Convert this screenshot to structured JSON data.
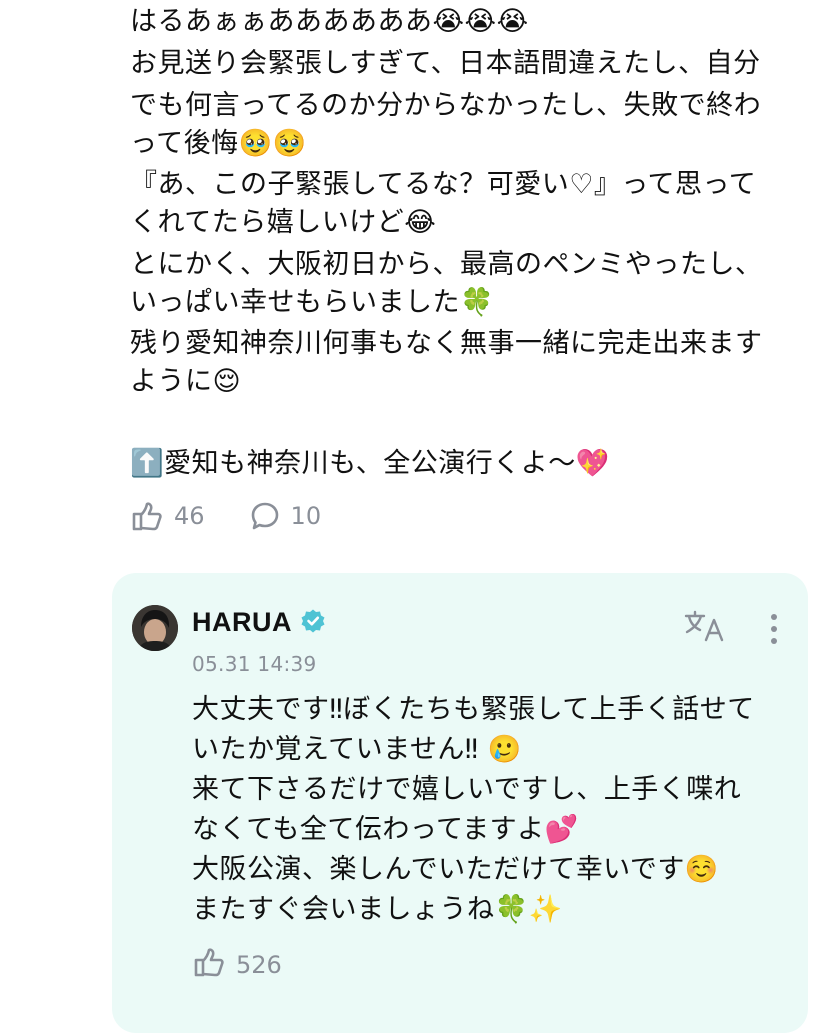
{
  "post": {
    "lines": [
      "はるあぁぁああああああ😭😭😭",
      "お見送り会緊張しすぎて、日本語間違えたし、自分",
      "でも何言ってるのか分からなかったし、失敗で終わ",
      "って後悔🥹🥹",
      "『あ、この子緊張してるな？可愛い♡』って思って",
      "くれてたら嬉しいけど😂",
      "とにかく、大阪初日から、最高のペンミやったし、",
      "いっぱい幸せもらいました🍀",
      "残り愛知神奈川何事もなく無事一緒に完走出来ます",
      "ように😌",
      "",
      "⬆️愛知も神奈川も、全公演行くよ〜💖"
    ],
    "like_count": "46",
    "comment_count": "10"
  },
  "reply": {
    "username": "HARUA",
    "timestamp": "05.31 14:39",
    "lines": [
      "大丈夫です‼︎ぼくたちも緊張して上手く話せて",
      "いたか覚えていません‼︎ 🥲",
      "来て下さるだけで嬉しいですし、上手く喋れ",
      "なくても全て伝わってますよ💕",
      "大阪公演、楽しんでいただけて幸いです☺️",
      "またすぐ会いましょうね🍀✨"
    ],
    "like_count": "526"
  },
  "colors": {
    "card_background": "#ebfaf7",
    "muted_text": "#8a8f98",
    "verified_badge": "#4fc3d4"
  },
  "icons": [
    "like-icon",
    "comment-icon",
    "verified-badge-icon",
    "translate-icon",
    "more-icon",
    "avatar"
  ]
}
